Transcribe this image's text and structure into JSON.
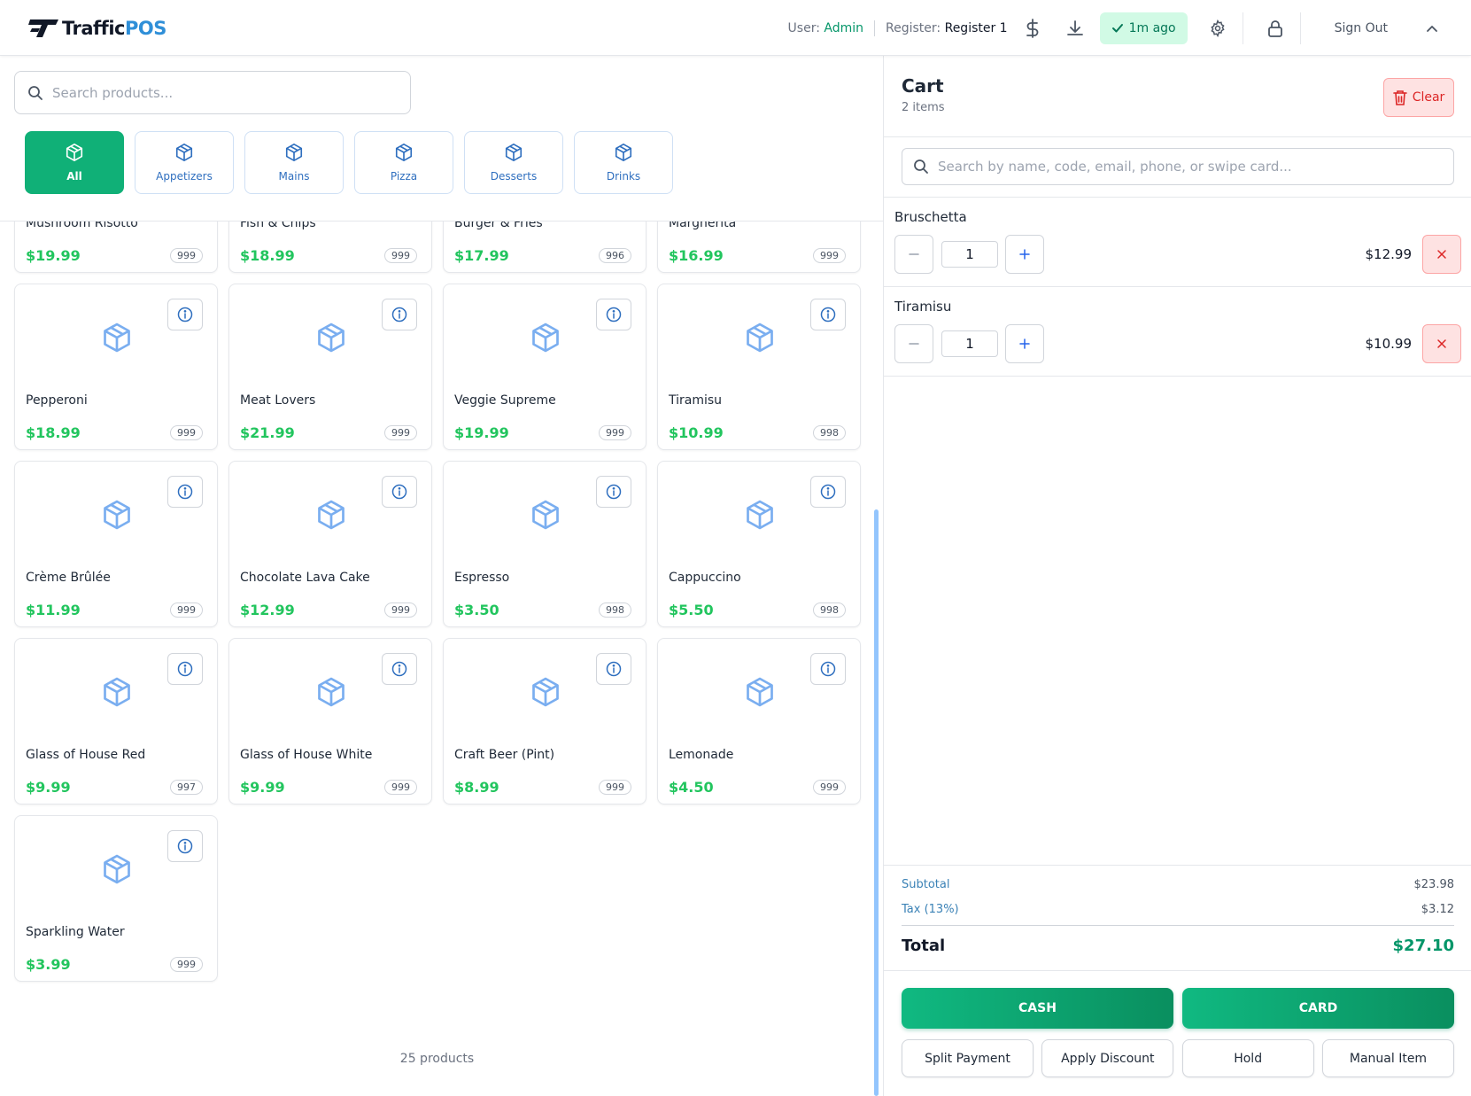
{
  "brand": {
    "name_dark": "Traffic",
    "name_blue": "POS"
  },
  "header": {
    "user_label": "User:",
    "user_value": "Admin",
    "register_label": "Register:",
    "register_value": "Register 1",
    "sync_status": "1m ago",
    "sign_out": "Sign Out",
    "icons": [
      "dollar-icon",
      "download-icon",
      "check-icon",
      "gear-icon",
      "lock-icon",
      "chevron-up-icon"
    ]
  },
  "search": {
    "placeholder": "Search products..."
  },
  "categories": [
    {
      "label": "All",
      "active": true
    },
    {
      "label": "Appetizers",
      "active": false
    },
    {
      "label": "Mains",
      "active": false
    },
    {
      "label": "Pizza",
      "active": false
    },
    {
      "label": "Desserts",
      "active": false
    },
    {
      "label": "Drinks",
      "active": false
    }
  ],
  "products": [
    {
      "name": "Mushroom Risotto",
      "price": "$19.99",
      "stock": "999"
    },
    {
      "name": "Fish & Chips",
      "price": "$18.99",
      "stock": "999"
    },
    {
      "name": "Burger & Fries",
      "price": "$17.99",
      "stock": "996"
    },
    {
      "name": "Margherita",
      "price": "$16.99",
      "stock": "999"
    },
    {
      "name": "Pepperoni",
      "price": "$18.99",
      "stock": "999"
    },
    {
      "name": "Meat Lovers",
      "price": "$21.99",
      "stock": "999"
    },
    {
      "name": "Veggie Supreme",
      "price": "$19.99",
      "stock": "999"
    },
    {
      "name": "Tiramisu",
      "price": "$10.99",
      "stock": "998"
    },
    {
      "name": "Crème Brûlée",
      "price": "$11.99",
      "stock": "999"
    },
    {
      "name": "Chocolate Lava Cake",
      "price": "$12.99",
      "stock": "999"
    },
    {
      "name": "Espresso",
      "price": "$3.50",
      "stock": "998"
    },
    {
      "name": "Cappuccino",
      "price": "$5.50",
      "stock": "998"
    },
    {
      "name": "Glass of House Red",
      "price": "$9.99",
      "stock": "997"
    },
    {
      "name": "Glass of House White",
      "price": "$9.99",
      "stock": "999"
    },
    {
      "name": "Craft Beer (Pint)",
      "price": "$8.99",
      "stock": "999"
    },
    {
      "name": "Lemonade",
      "price": "$4.50",
      "stock": "999"
    },
    {
      "name": "Sparkling Water",
      "price": "$3.99",
      "stock": "999"
    }
  ],
  "product_count": "25 products",
  "cart": {
    "title": "Cart",
    "item_count": "2 items",
    "clear_label": "Clear",
    "customer_search_placeholder": "Search by name, code, email, phone, or swipe card...",
    "items": [
      {
        "name": "Bruschetta",
        "qty": "1",
        "price": "$12.99"
      },
      {
        "name": "Tiramisu",
        "qty": "1",
        "price": "$10.99"
      }
    ],
    "subtotal_label": "Subtotal",
    "subtotal": "$23.98",
    "tax_label": "Tax (13%)",
    "tax": "$3.12",
    "total_label": "Total",
    "total": "$27.10",
    "cash_label": "CASH",
    "card_label": "CARD",
    "actions": [
      "Split Payment",
      "Apply Discount",
      "Hold",
      "Manual Item"
    ]
  },
  "colors": {
    "accent_green": "#10b077",
    "price_green": "#22c55e",
    "brand_blue": "#2f8fd8",
    "danger_red": "#dc2626"
  }
}
